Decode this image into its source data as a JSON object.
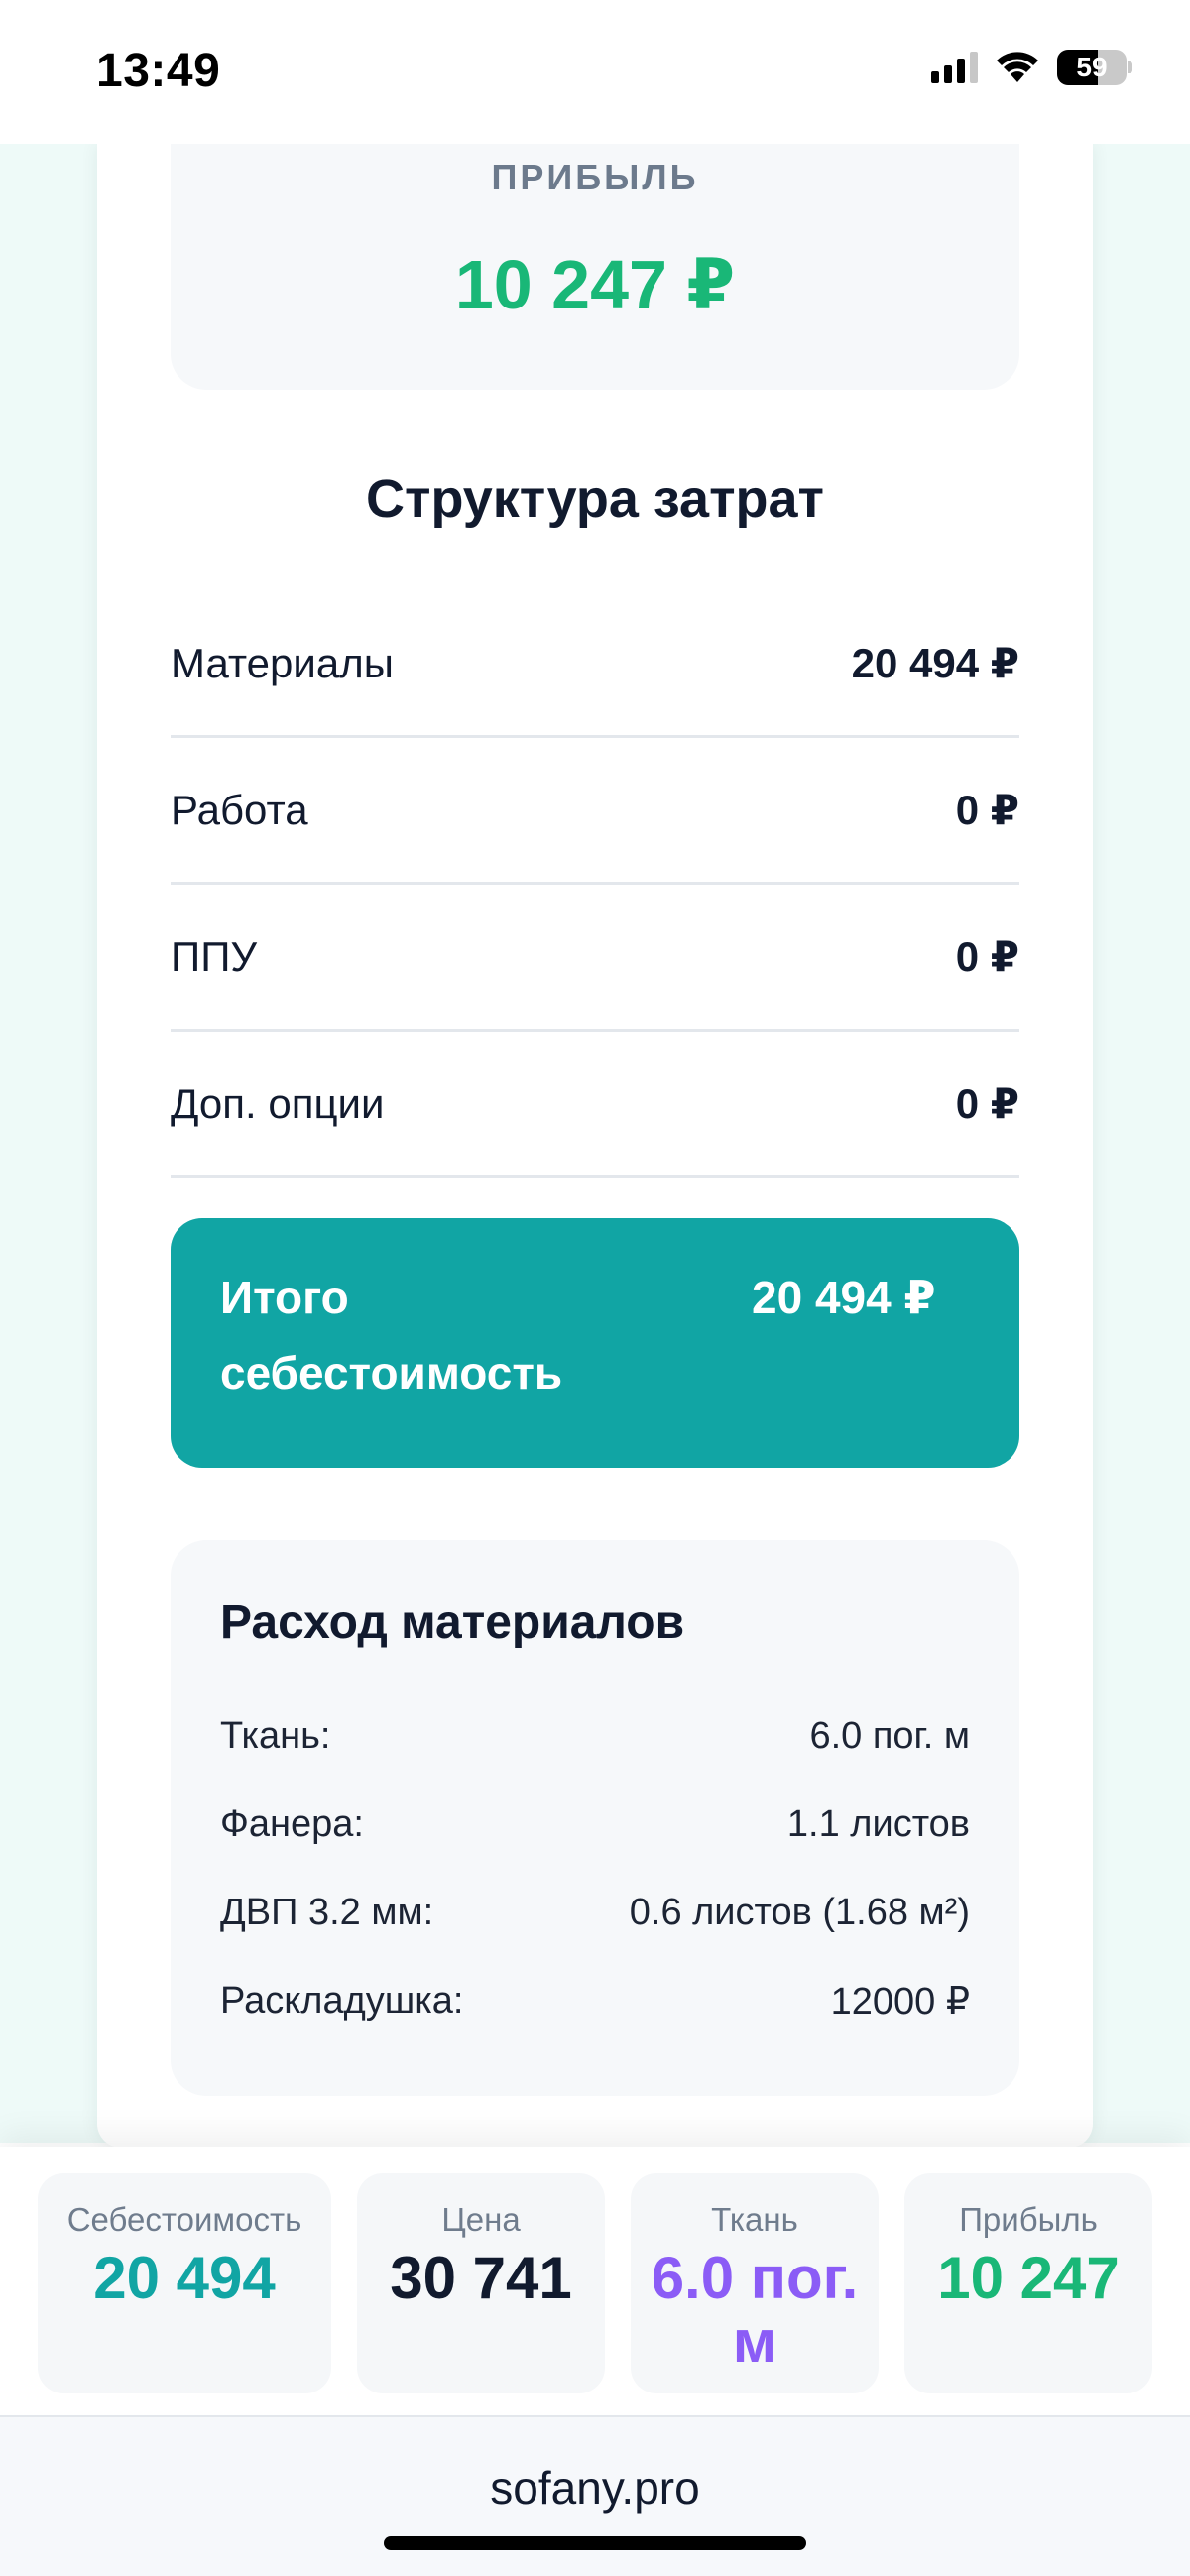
{
  "status_bar": {
    "time": "13:49",
    "battery": "59",
    "battery_level": 0.59,
    "signal_bars": 3,
    "icons": [
      "signal-icon",
      "wifi-icon",
      "battery-icon"
    ]
  },
  "profit": {
    "label": "ПРИБЫЛЬ",
    "value": "10 247 ₽"
  },
  "cost_structure": {
    "title": "Структура затрат",
    "rows": [
      {
        "label": "Материалы",
        "value": "20 494 ₽"
      },
      {
        "label": "Работа",
        "value": "0 ₽"
      },
      {
        "label": "ППУ",
        "value": "0 ₽"
      },
      {
        "label": "Доп. опции",
        "value": "0 ₽"
      }
    ],
    "total": {
      "label": "Итого себестоимость",
      "value": "20 494 ₽"
    }
  },
  "materials": {
    "title": "Расход материалов",
    "rows": [
      {
        "label": "Ткань:",
        "value": "6.0 пог. м"
      },
      {
        "label": "Фанера:",
        "value": "1.1 листов"
      },
      {
        "label": "ДВП 3.2 мм:",
        "value": "0.6 листов (1.68 м²)"
      },
      {
        "label": "Раскладушка:",
        "value": "12000 ₽"
      }
    ]
  },
  "stats": [
    {
      "label": "Себестоимость",
      "value": "20 494"
    },
    {
      "label": "Цена",
      "value": "30 741"
    },
    {
      "label": "Ткань",
      "value": "6.0 пог. м"
    },
    {
      "label": "Прибыль",
      "value": "10 247"
    }
  ],
  "footer": {
    "domain": "sofany.pro"
  },
  "colors": {
    "accent_teal": "#11a5a4",
    "profit_green": "#19b777",
    "fabric_purple": "#8b5cf6",
    "text_dark": "#111a2e",
    "muted": "#6c7a8c"
  }
}
